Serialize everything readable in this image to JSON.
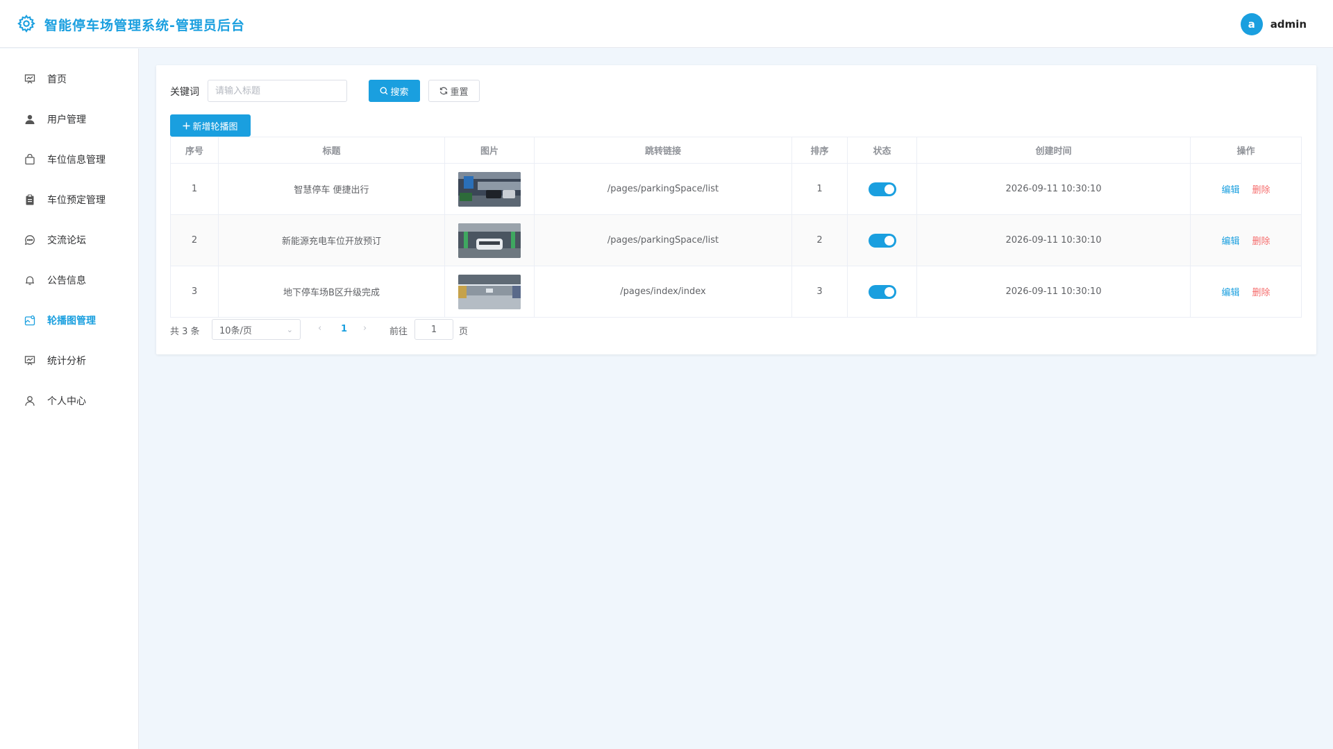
{
  "header": {
    "title": "智能停车场管理系统-管理员后台",
    "avatar_letter": "a",
    "username": "admin"
  },
  "sidebar": {
    "items": [
      {
        "label": "首页",
        "icon": "presentation-icon"
      },
      {
        "label": "用户管理",
        "icon": "user-icon"
      },
      {
        "label": "车位信息管理",
        "icon": "bag-icon"
      },
      {
        "label": "车位预定管理",
        "icon": "clipboard-icon"
      },
      {
        "label": "交流论坛",
        "icon": "chat-icon"
      },
      {
        "label": "公告信息",
        "icon": "bell-icon"
      },
      {
        "label": "轮播图管理",
        "icon": "image-icon",
        "active": true
      },
      {
        "label": "统计分析",
        "icon": "presentation-icon"
      },
      {
        "label": "个人中心",
        "icon": "user-outline-icon"
      }
    ]
  },
  "search": {
    "label": "关键词",
    "placeholder": "请输入标题",
    "value": "",
    "search_label": "搜索",
    "reset_label": "重置"
  },
  "toolbar": {
    "add_label": "新增轮播图"
  },
  "table": {
    "columns": [
      "序号",
      "标题",
      "图片",
      "跳转链接",
      "排序",
      "状态",
      "创建时间",
      "操作"
    ],
    "edit_label": "编辑",
    "delete_label": "删除",
    "rows": [
      {
        "index": "1",
        "title": "智慧停车 便捷出行",
        "link": "/pages/parkingSpace/list",
        "sort": "1",
        "status": true,
        "created": "2026-09-11 10:30:10"
      },
      {
        "index": "2",
        "title": "新能源充电车位开放预订",
        "link": "/pages/parkingSpace/list",
        "sort": "2",
        "status": true,
        "created": "2026-09-11 10:30:10"
      },
      {
        "index": "3",
        "title": "地下停车场B区升级完成",
        "link": "/pages/index/index",
        "sort": "3",
        "status": true,
        "created": "2026-09-11 10:30:10"
      }
    ]
  },
  "pagination": {
    "total_text": "共 3 条",
    "page_size": "10条/页",
    "current_page": "1",
    "goto_label": "前往",
    "goto_value": "1",
    "page_suffix": "页"
  },
  "colors": {
    "accent": "#1a9fdf",
    "danger": "#f56c6c",
    "background": "#f0f6fc"
  }
}
